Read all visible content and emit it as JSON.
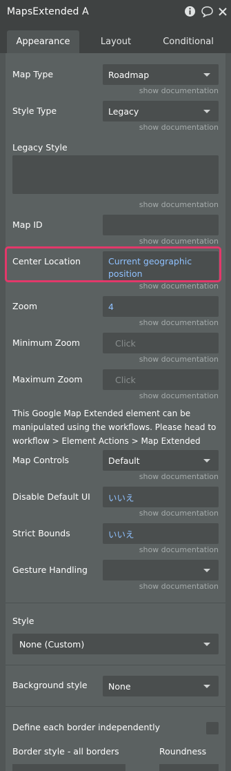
{
  "header": {
    "title": "MapsExtended A"
  },
  "tabs": [
    {
      "label": "Appearance"
    },
    {
      "label": "Layout"
    },
    {
      "label": "Conditional"
    }
  ],
  "doc_link": "show documentation",
  "fields": {
    "map_type": {
      "label": "Map Type",
      "value": "Roadmap"
    },
    "style_type": {
      "label": "Style Type",
      "value": "Legacy"
    },
    "legacy_style": {
      "label": "Legacy Style"
    },
    "map_id": {
      "label": "Map ID"
    },
    "center_location": {
      "label": "Center Location",
      "value_line1": "Current geographic",
      "value_line2": "position"
    },
    "zoom": {
      "label": "Zoom",
      "value": "4"
    },
    "min_zoom": {
      "label": "Minimum Zoom",
      "placeholder": "Click"
    },
    "max_zoom": {
      "label": "Maximum Zoom",
      "placeholder": "Click"
    },
    "info_text": "This Google Map Extended element can be manipulated using the workflows. Please head to workflow > Element Actions > Map Extended",
    "map_controls": {
      "label": "Map Controls",
      "value": "Default"
    },
    "disable_default_ui": {
      "label": "Disable Default UI",
      "value": "いいえ"
    },
    "strict_bounds": {
      "label": "Strict Bounds",
      "value": "いいえ"
    },
    "gesture_handling": {
      "label": "Gesture Handling"
    }
  },
  "style_section": {
    "label": "Style",
    "value": "None (Custom)"
  },
  "background_style": {
    "label": "Background style",
    "value": "None"
  },
  "border": {
    "independent_label": "Define each border independently",
    "style_label": "Border style - all borders",
    "roundness_label": "Roundness"
  },
  "colors": {
    "highlight": "#e3386a",
    "link_value": "#8fc1ff"
  }
}
